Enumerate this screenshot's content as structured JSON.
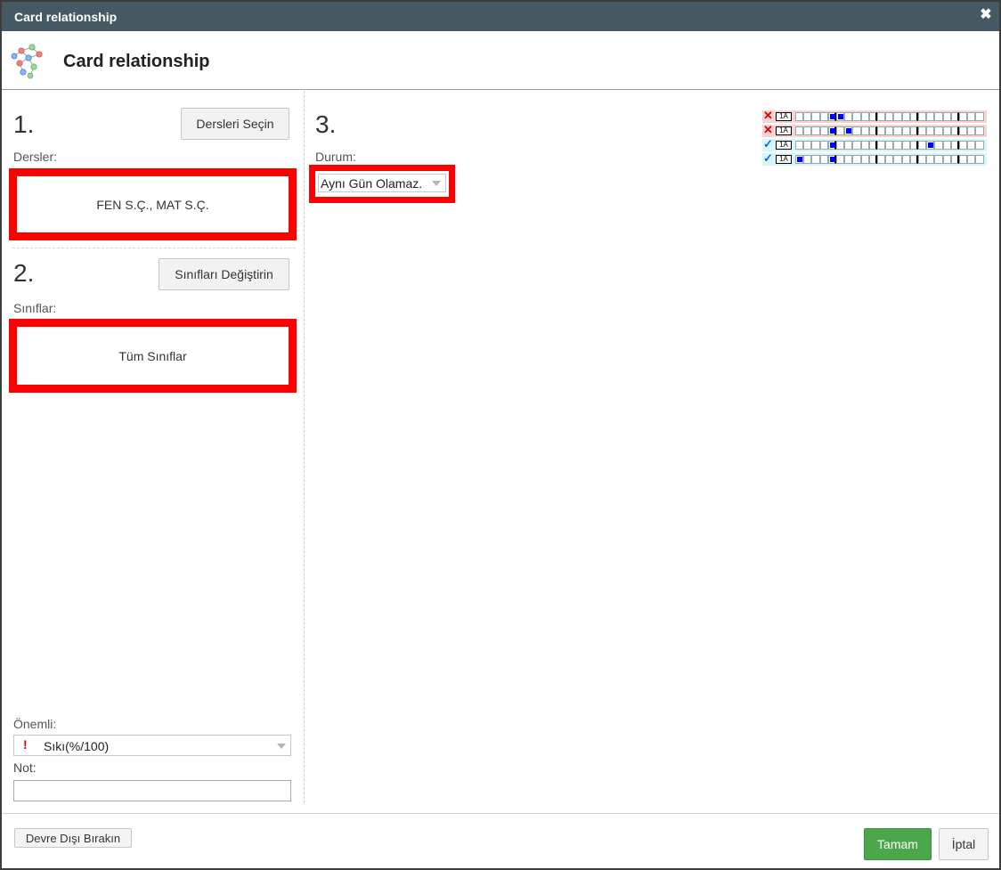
{
  "window": {
    "title": "Card relationship",
    "close_icon": "close-icon"
  },
  "header": {
    "title": "Card relationship",
    "icon": "network-nodes-icon"
  },
  "section1": {
    "number": "1.",
    "button_label": "Dersleri Seçin",
    "field_label": "Dersler:",
    "value": "FEN S.Ç., MAT S.Ç."
  },
  "section2": {
    "number": "2.",
    "button_label": "Sınıfları Değiştirin",
    "field_label": "Sınıflar:",
    "value": "Tüm Sınıflar"
  },
  "section3": {
    "number": "3.",
    "field_label": "Durum:",
    "select_value": "Aynı Gün Olamaz."
  },
  "importance": {
    "label": "Önemli:",
    "select_value": "Sıkı(%/100)",
    "marker": "!"
  },
  "note": {
    "label": "Not:",
    "value": ""
  },
  "footer": {
    "disable_label": "Devre Dışı Bırakın",
    "ok_label": "Tamam",
    "cancel_label": "İptal"
  },
  "preview": {
    "rows": [
      {
        "status": "invalid",
        "tag": "1A",
        "filled": [
          4,
          5
        ]
      },
      {
        "status": "invalid",
        "tag": "1A",
        "filled": [
          4,
          6
        ]
      },
      {
        "status": "valid",
        "tag": "1A",
        "filled": [
          4,
          16
        ]
      },
      {
        "status": "valid",
        "tag": "1A",
        "filled": [
          0,
          4
        ]
      }
    ],
    "colors": {
      "invalid_bg": "#f7d4d4",
      "valid_bg": "#d6f7fa",
      "filled": "#0000ff",
      "invalid_mark": "#e00000",
      "valid_mark": "#1b62d6"
    }
  }
}
